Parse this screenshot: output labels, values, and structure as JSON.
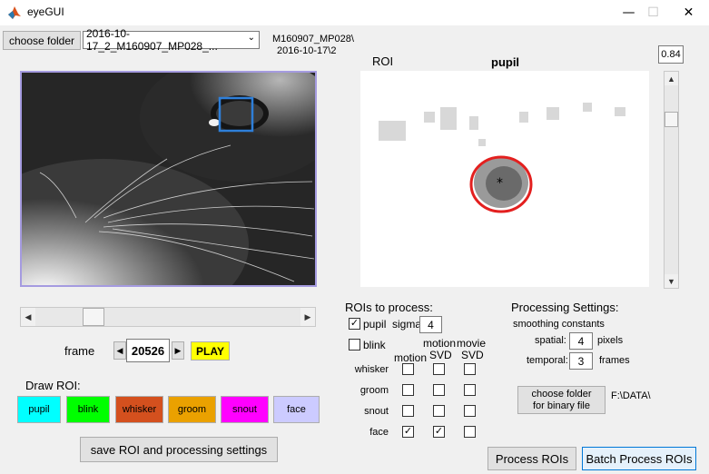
{
  "window": {
    "title": "eyeGUI",
    "minimize": "—",
    "maximize": "☐",
    "close": "✕"
  },
  "header": {
    "choose_folder_label": "choose folder",
    "folder_value": "2016-10-17_2_M160907_MP028_...",
    "path_line1": "M160907_MP028\\",
    "path_line2": "2016-10-17\\2"
  },
  "roi_view": {
    "roi_label": "ROI",
    "pupil_label": "pupil",
    "threshold_value": "0.84"
  },
  "playback": {
    "frame_label": "frame",
    "frame_value": "20526",
    "play_label": "PLAY"
  },
  "draw_roi": {
    "title": "Draw ROI:",
    "buttons": [
      {
        "label": "pupil",
        "color": "#00ffff"
      },
      {
        "label": "blink",
        "color": "#00ff00"
      },
      {
        "label": "whisker",
        "color": "#d4501e"
      },
      {
        "label": "groom",
        "color": "#eaa100"
      },
      {
        "label": "snout",
        "color": "#ff00ff"
      },
      {
        "label": "face",
        "color": "#cccbff"
      }
    ]
  },
  "save_button_label": "save ROI and processing settings",
  "rois_to_process": {
    "title": "ROIs to process:",
    "pupil_label": "pupil",
    "pupil_checked": true,
    "sigma_label": "sigma",
    "sigma_value": "4",
    "blink_label": "blink",
    "blink_checked": false,
    "col_motion": "motion",
    "col_motion_svd_1": "motion",
    "col_motion_svd_2": "SVD",
    "col_movie_svd_1": "movie",
    "col_movie_svd_2": "SVD",
    "rows": [
      {
        "label": "whisker",
        "checks": [
          "",
          "",
          ""
        ]
      },
      {
        "label": "groom",
        "checks": [
          "",
          "",
          ""
        ]
      },
      {
        "label": "snout",
        "checks": [
          "",
          "",
          ""
        ]
      },
      {
        "label": "face",
        "checks": [
          "✓",
          "✓",
          ""
        ]
      }
    ]
  },
  "processing": {
    "title": "Processing Settings:",
    "smoothing_label": "smoothing constants",
    "spatial_label": "spatial:",
    "spatial_value": "4",
    "spatial_unit": "pixels",
    "temporal_label": "temporal:",
    "temporal_value": "3",
    "temporal_unit": "frames",
    "choose_binary_line1": "choose folder",
    "choose_binary_line2": "for binary file",
    "binary_path": "F:\\DATA\\"
  },
  "process_rois_label": "Process ROIs",
  "batch_process_label": "Batch Process ROIs"
}
